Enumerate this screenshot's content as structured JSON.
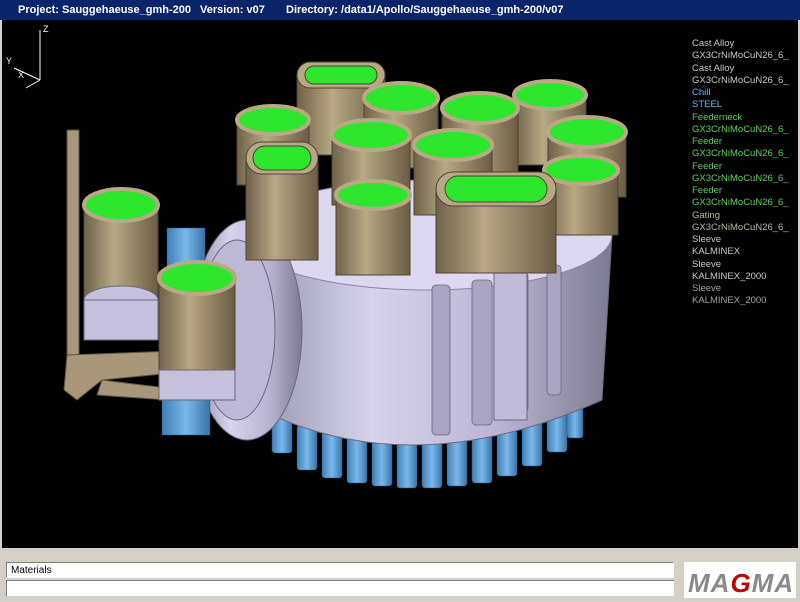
{
  "titlebar": {
    "project": "Project: Sauggehaeuse_gmh-200",
    "version": "Version: v07",
    "directory": "Directory: /data1/Apollo/Sauggehaeuse_gmh-200/v07"
  },
  "legend": [
    {
      "text": "Cast Alloy",
      "color": "#c8c8c8"
    },
    {
      "text": "GX3CrNiMoCuN26_6_",
      "color": "#c8c8c8"
    },
    {
      "text": "Cast Alloy",
      "color": "#c8c8c8"
    },
    {
      "text": "GX3CrNiMoCuN26_6_",
      "color": "#c8c8c8"
    },
    {
      "text": "Chill",
      "color": "#6fb7ff"
    },
    {
      "text": "STEEL",
      "color": "#6fb7ff"
    },
    {
      "text": "Feederneck",
      "color": "#5fcf5f"
    },
    {
      "text": "GX3CrNiMoCuN26_6_",
      "color": "#5fcf5f"
    },
    {
      "text": "Feeder",
      "color": "#5fcf5f"
    },
    {
      "text": "GX3CrNiMoCuN26_6_",
      "color": "#5fcf5f"
    },
    {
      "text": "Feeder",
      "color": "#5fcf5f"
    },
    {
      "text": "GX3CrNiMoCuN26_6_",
      "color": "#5fcf5f"
    },
    {
      "text": "Feeder",
      "color": "#5fcf5f"
    },
    {
      "text": "GX3CrNiMoCuN26_6_",
      "color": "#5fcf5f"
    },
    {
      "text": "Gating",
      "color": "#bdb39b"
    },
    {
      "text": "GX3CrNiMoCuN26_6_",
      "color": "#bdb39b"
    },
    {
      "text": "Sleeve",
      "color": "#c8c8c8"
    },
    {
      "text": "KALMINEX",
      "color": "#c8c8c8"
    },
    {
      "text": "Sleeve",
      "color": "#c8c8c8"
    },
    {
      "text": "KALMINEX_2000",
      "color": "#c8c8c8"
    },
    {
      "text": "Sleeve",
      "color": "#a0a0a0"
    },
    {
      "text": "KALMINEX_2000",
      "color": "#a0a0a0"
    }
  ],
  "axes": {
    "z": "Z",
    "y": "Y",
    "x": "X"
  },
  "status": {
    "label": "Materials"
  },
  "logo": {
    "text_a": "MA",
    "text_g": "G",
    "text_b": "MA"
  },
  "colors": {
    "casting": "#c5c1dc",
    "feeder": "#8c7c5c",
    "feeder_top": "#2ee62e",
    "chill": "#5a9fd6",
    "titlebar": "#0a246a"
  }
}
